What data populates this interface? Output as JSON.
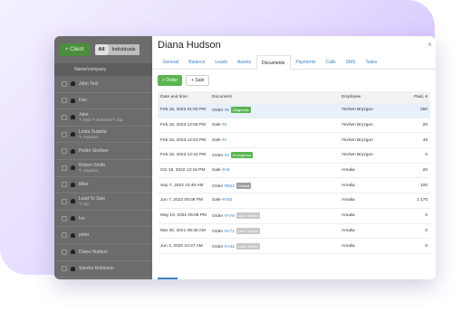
{
  "left": {
    "new_client_label": "+ Client",
    "filter_all": "All",
    "filter_individuals": "Individuals",
    "column_header": "Name/company",
    "rows": [
      {
        "name": "John Test",
        "sub": ""
      },
      {
        "name": "Dan",
        "sub": ""
      },
      {
        "name": "Jake",
        "sub": "✎ best ✎ Botanist ✎ fap"
      },
      {
        "name": "Linda Sudafal",
        "sub": "✎ regulars"
      },
      {
        "name": "Pedro Skoltser",
        "sub": ""
      },
      {
        "name": "Robert Smith",
        "sub": "✎ regulars"
      },
      {
        "name": "Mike",
        "sub": ""
      },
      {
        "name": "Lead To Sale",
        "sub": "✎ vip"
      },
      {
        "name": "Ivo",
        "sub": ""
      },
      {
        "name": "peter",
        "sub": ""
      },
      {
        "name": "Diana Hudson",
        "sub": ""
      },
      {
        "name": "Sandra Robinson",
        "sub": ""
      }
    ]
  },
  "panel": {
    "title": "Diana Hudson",
    "close_symbol": "×",
    "tabs": [
      "General",
      "Balance",
      "Leads",
      "Assets",
      "Documents",
      "Payments",
      "Calls",
      "SMS",
      "Tasks"
    ],
    "active_tab": "Documents",
    "order_button": "+ Order",
    "sale_button": "+ Sale",
    "table": {
      "headers": [
        "Date and time",
        "Document",
        "Employee",
        "Paid, €"
      ],
      "rows": [
        {
          "date": "Feb 15, 2023 01:00 PM",
          "doc_type": "Order",
          "doc_num": "#5",
          "status": "Diagnosis",
          "status_color": "#5ab552",
          "employee": "Yevhen Bryzgun",
          "paid": "250"
        },
        {
          "date": "Feb 15, 2023 12:56 PM",
          "doc_type": "Sale",
          "doc_num": "#2",
          "status": "",
          "status_color": "",
          "employee": "Yevhen Bryzgun",
          "paid": "20"
        },
        {
          "date": "Feb 15, 2023 12:53 PM",
          "doc_type": "Sale",
          "doc_num": "#1",
          "status": "",
          "status_color": "",
          "employee": "Yevhen Bryzgun",
          "paid": "49"
        },
        {
          "date": "Feb 15, 2023 12:42 PM",
          "doc_type": "Order",
          "doc_num": "#4",
          "status": "In progress",
          "status_color": "#5ab552",
          "employee": "Yevhen Bryzgun",
          "paid": "0"
        },
        {
          "date": "Oct 18, 2022 12:18 PM",
          "doc_type": "Sale",
          "doc_num": "#A8",
          "status": "",
          "status_color": "",
          "employee": "Amalia",
          "paid": "20"
        },
        {
          "date": "Sep 7, 2022 10:46 AM",
          "doc_type": "Order",
          "doc_num": "#B23",
          "status": "Closed",
          "status_color": "#9e9e9e",
          "employee": "Amalia",
          "paid": "100"
        },
        {
          "date": "Jun 7, 2022 05:08 PM",
          "doc_type": "Sale",
          "doc_num": "#A93",
          "status": "",
          "status_color": "",
          "employee": "Amalia",
          "paid": "1 170"
        },
        {
          "date": "May 19, 2021 06:05 PM",
          "doc_type": "Order",
          "doc_num": "#A79",
          "status": "Lost / Failed",
          "status_color": "#c8c8c8",
          "employee": "Amalia",
          "paid": "0"
        },
        {
          "date": "Mar 30, 2021 09:30 AM",
          "doc_type": "Order",
          "doc_num": "#A71",
          "status": "Lost / Failed",
          "status_color": "#c8c8c8",
          "employee": "Amalia",
          "paid": "0"
        },
        {
          "date": "Jun 4, 2020 10:47 AM",
          "doc_type": "Order",
          "doc_num": "#A32",
          "status": "Lost / Failed",
          "status_color": "#c8c8c8",
          "employee": "Amalia",
          "paid": "0"
        }
      ]
    }
  }
}
